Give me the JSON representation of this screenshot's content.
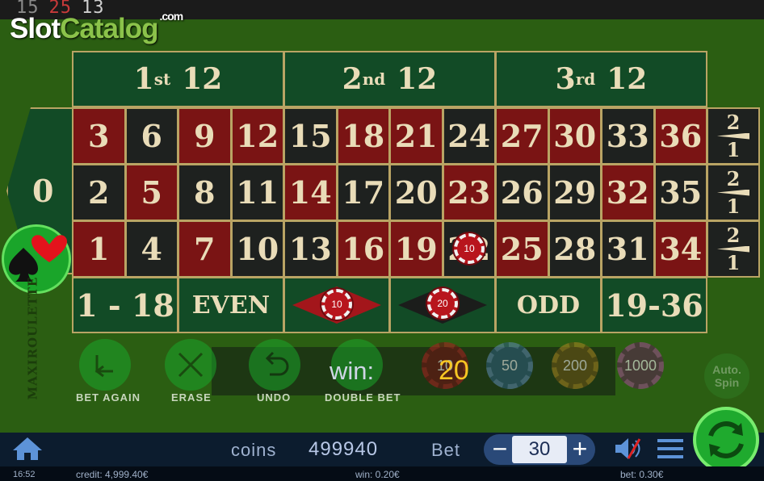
{
  "history": [
    {
      "n": "15",
      "color": "#8a8a8a"
    },
    {
      "n": "25",
      "color": "#c83a3a"
    },
    {
      "n": "13",
      "color": "#cfcfcf"
    }
  ],
  "logo": {
    "part1": "Slot",
    "part2": "Catalog",
    "suffix": ".com"
  },
  "table": {
    "dozens": [
      {
        "n": "1",
        "sup": "st",
        "label": "12"
      },
      {
        "n": "2",
        "sup": "nd",
        "label": "12"
      },
      {
        "n": "3",
        "sup": "rd",
        "label": "12"
      }
    ],
    "zero": "0",
    "rows": [
      [
        "3",
        "6",
        "9",
        "12",
        "15",
        "18",
        "21",
        "24",
        "27",
        "30",
        "33",
        "36"
      ],
      [
        "2",
        "5",
        "8",
        "11",
        "14",
        "17",
        "20",
        "23",
        "26",
        "29",
        "32",
        "35"
      ],
      [
        "1",
        "4",
        "7",
        "10",
        "13",
        "16",
        "19",
        "22",
        "25",
        "28",
        "31",
        "34"
      ]
    ],
    "row_colors": [
      [
        "red",
        "blk",
        "red",
        "red",
        "blk",
        "red",
        "red",
        "blk",
        "red",
        "red",
        "blk",
        "red"
      ],
      [
        "blk",
        "red",
        "blk",
        "blk",
        "red",
        "blk",
        "blk",
        "red",
        "blk",
        "blk",
        "red",
        "blk"
      ],
      [
        "red",
        "blk",
        "red",
        "blk",
        "blk",
        "red",
        "red",
        "blk",
        "red",
        "blk",
        "blk",
        "red"
      ]
    ],
    "column_bet": {
      "top": "2",
      "bottom": "1"
    },
    "outside": [
      "1 - 18",
      "EVEN",
      "",
      "",
      "ODD",
      "19-36"
    ],
    "chips_on_table": [
      {
        "spot": "22",
        "value": "10"
      },
      {
        "spot": "red",
        "value": "10"
      },
      {
        "spot": "black",
        "value": "20"
      }
    ],
    "vertical_brand": "MAXIROULETTE"
  },
  "controls": {
    "bet_again": "BET AGAIN",
    "erase": "ERASE",
    "undo": "UNDO",
    "double_bet": "DOUBLE BET",
    "chips": [
      "10",
      "50",
      "200",
      "1000"
    ],
    "auto_spin": "Auto. Spin"
  },
  "win": {
    "label": "win:",
    "value": "20"
  },
  "bottom": {
    "coins_label": "coins",
    "coins_value": "499940",
    "bet_label": "Bet",
    "bet_value": "30",
    "minus": "−",
    "plus": "+"
  },
  "status": {
    "time": "16:52",
    "credit": "credit: 4,999.40€",
    "win": "win: 0.20€",
    "bet": "bet: 0.30€"
  },
  "colors": {
    "felt": "#2b5e12",
    "red": "#7a1414",
    "black": "#1e211f",
    "green": "#124b26",
    "gold": "#f7c623"
  }
}
